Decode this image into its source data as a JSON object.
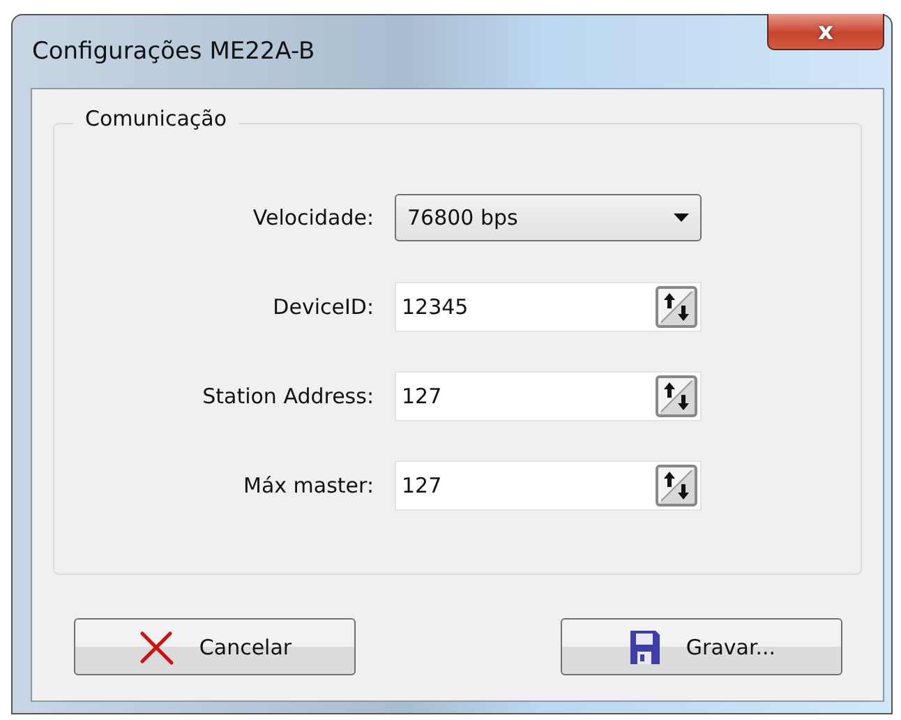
{
  "window": {
    "title": "Configurações ME22A-B",
    "close_label": "x"
  },
  "group": {
    "title": "Comunicação"
  },
  "fields": [
    {
      "kind": "dropdown",
      "label": "Velocidade:",
      "value": "76800 bps"
    },
    {
      "kind": "spinner",
      "label": "DeviceID:",
      "value": "12345"
    },
    {
      "kind": "spinner",
      "label": "Station Address:",
      "value": "127"
    },
    {
      "kind": "spinner",
      "label": "Máx master:",
      "value": "127"
    }
  ],
  "buttons": [
    {
      "kind": "cancel",
      "label": "Cancelar"
    },
    {
      "kind": "save",
      "label": "Gravar..."
    }
  ]
}
